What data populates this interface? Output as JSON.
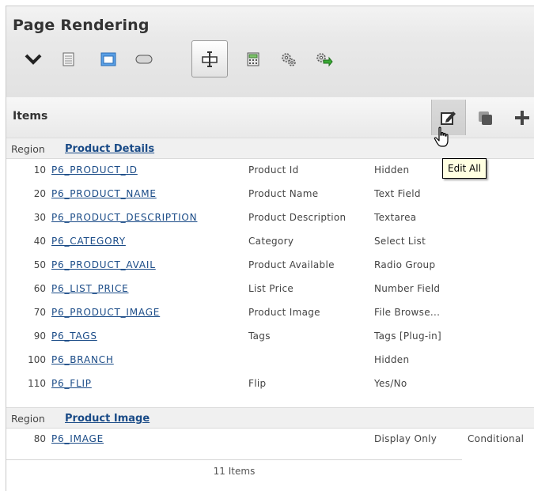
{
  "header": {
    "title": "Page Rendering",
    "toolbar": [
      {
        "icon": "chevron-down-icon",
        "active": false
      },
      {
        "icon": "document-icon",
        "active": false
      },
      {
        "icon": "region-icon",
        "active": false
      },
      {
        "icon": "button-icon",
        "active": false
      },
      {
        "icon": "item-icon",
        "active": true
      },
      {
        "icon": "computation-icon",
        "active": false
      },
      {
        "icon": "process-icon",
        "active": false
      },
      {
        "icon": "shared-components-icon",
        "active": false
      }
    ]
  },
  "items_panel": {
    "title": "Items",
    "buttons": [
      "edit-all-icon",
      "copy-icon",
      "add-icon"
    ],
    "tooltip": "Edit All"
  },
  "regions": [
    {
      "label": "Region",
      "name": "Product Details",
      "items": [
        {
          "seq": "10",
          "name": "P6_PRODUCT_ID",
          "label": "Product Id",
          "type": "Hidden",
          "condition": ""
        },
        {
          "seq": "20",
          "name": "P6_PRODUCT_NAME",
          "label": "Product Name",
          "type": "Text Field",
          "condition": ""
        },
        {
          "seq": "30",
          "name": "P6_PRODUCT_DESCRIPTION",
          "label": "Product Description",
          "type": "Textarea",
          "condition": ""
        },
        {
          "seq": "40",
          "name": "P6_CATEGORY",
          "label": "Category",
          "type": "Select List",
          "condition": ""
        },
        {
          "seq": "50",
          "name": "P6_PRODUCT_AVAIL",
          "label": "Product Available",
          "type": "Radio Group",
          "condition": ""
        },
        {
          "seq": "60",
          "name": "P6_LIST_PRICE",
          "label": "List Price",
          "type": "Number Field",
          "condition": ""
        },
        {
          "seq": "70",
          "name": "P6_PRODUCT_IMAGE",
          "label": "Product Image",
          "type": "File Browse...",
          "condition": ""
        },
        {
          "seq": "90",
          "name": "P6_TAGS",
          "label": "Tags",
          "type": "Tags [Plug-in]",
          "condition": ""
        },
        {
          "seq": "100",
          "name": "P6_BRANCH",
          "label": "",
          "type": "Hidden",
          "condition": ""
        },
        {
          "seq": "110",
          "name": "P6_FLIP",
          "label": "Flip",
          "type": "Yes/No",
          "condition": ""
        }
      ]
    },
    {
      "label": "Region",
      "name": "Product Image",
      "items": [
        {
          "seq": "80",
          "name": "P6_IMAGE",
          "label": "",
          "type": "Display Only",
          "condition": "Conditional"
        }
      ]
    }
  ],
  "footer": "11 Items"
}
